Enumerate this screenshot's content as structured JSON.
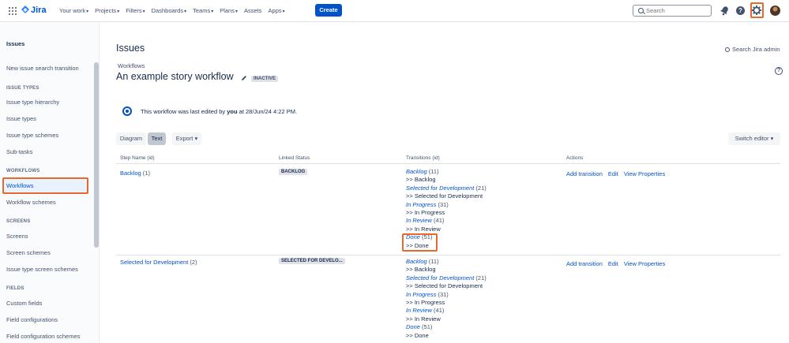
{
  "topnav": {
    "app_name": "Jira",
    "items": [
      "Your work",
      "Projects",
      "Filters",
      "Dashboards",
      "Teams",
      "Plans",
      "Assets",
      "Apps"
    ],
    "create_label": "Create",
    "search_placeholder": "Search",
    "help_glyph": "?",
    "brand_color": "#0052cc",
    "highlight_color": "#e8692c"
  },
  "sidebar": {
    "title": "Issues",
    "link_transition": "New issue search transition",
    "issue_types_heading": "ISSUE TYPES",
    "issue_type_hierarchy": "Issue type hierarchy",
    "issue_types": "Issue types",
    "issue_type_schemes": "Issue type schemes",
    "sub_tasks": "Sub-tasks",
    "workflows_heading": "WORKFLOWS",
    "workflows": "Workflows",
    "workflow_schemes": "Workflow schemes",
    "screens_heading": "SCREENS",
    "screens": "Screens",
    "screen_schemes": "Screen schemes",
    "issue_type_screen_schemes": "Issue type screen schemes",
    "fields_heading": "FIELDS",
    "custom_fields": "Custom fields",
    "field_configurations": "Field configurations",
    "field_configuration_schemes": "Field configuration schemes"
  },
  "main": {
    "page_title": "Issues",
    "admin_search": "Search Jira admin",
    "breadcrumb": "Workflows",
    "workflow_title": "An example story workflow",
    "workflow_status": "INACTIVE",
    "help_glyph": "?",
    "info": {
      "prefix": "This workflow was last edited by ",
      "user": "you",
      "suffix": " at 28/Jun/24 4:22 PM."
    },
    "buttons": {
      "diagram": "Diagram",
      "text": "Text",
      "export": "Export",
      "switch_editor": "Switch editor"
    },
    "table": {
      "headers": [
        "Step Name (id)",
        "Linked Status",
        "Transitions (id)",
        "Actions"
      ],
      "rows": [
        {
          "step": "Backlog",
          "step_id": "(1)",
          "status": "BACKLOG",
          "transitions": [
            {
              "name": "Backlog",
              "id": "(11)",
              "target": ">> Backlog"
            },
            {
              "name": "Selected for Development",
              "id": "(21)",
              "target": ">> Selected for Development"
            },
            {
              "name": "In Progress",
              "id": "(31)",
              "target": ">> In Progress"
            },
            {
              "name": "In Review",
              "id": "(41)",
              "target": ">> In Review"
            },
            {
              "name": "Done",
              "id": "(51)",
              "target": ">> Done"
            }
          ],
          "actions": [
            "Add transition",
            "Edit",
            "View Properties"
          ]
        },
        {
          "step": "Selected for Development",
          "step_id": "(2)",
          "status": "SELECTED FOR DEVELO...",
          "transitions": [
            {
              "name": "Backlog",
              "id": "(11)",
              "target": ">> Backlog"
            },
            {
              "name": "Selected for Development",
              "id": "(21)",
              "target": ">> Selected for Development"
            },
            {
              "name": "In Progress",
              "id": "(31)",
              "target": ">> In Progress"
            },
            {
              "name": "In Review",
              "id": "(41)",
              "target": ">> In Review"
            },
            {
              "name": "Done",
              "id": "(51)",
              "target": ">> Done"
            }
          ],
          "actions": [
            "Add transition",
            "Edit",
            "View Properties"
          ]
        }
      ]
    }
  }
}
